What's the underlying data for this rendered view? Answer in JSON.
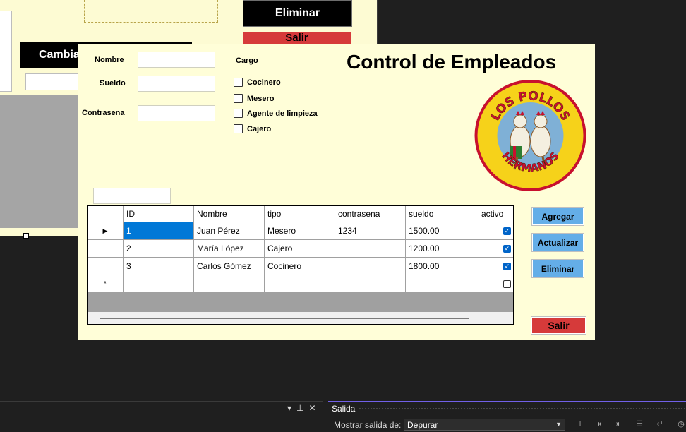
{
  "background_form": {
    "eliminar_label": "Eliminar",
    "salir_label": "Salir",
    "cambia_label": "Cambia"
  },
  "form": {
    "title": "Control de Empleados",
    "fields": {
      "nombre_label": "Nombre",
      "sueldo_label": "Sueldo",
      "contrasena_label": "Contrasena",
      "nombre_value": "",
      "sueldo_value": "",
      "contrasena_value": ""
    },
    "cargo": {
      "label": "Cargo",
      "options": [
        "Cocinero",
        "Mesero",
        "Agente de limpieza",
        "Cajero"
      ]
    },
    "logo_text": {
      "top": "LOS POLLOS",
      "bottom": "HERMANOS"
    },
    "grid": {
      "columns": [
        "ID",
        "Nombre",
        "tipo",
        "contrasena",
        "sueldo",
        "activo"
      ],
      "rows": [
        {
          "id": "1",
          "nombre": "Juan Pérez",
          "tipo": "Mesero",
          "contrasena": "1234",
          "sueldo": "1500.00",
          "activo": true
        },
        {
          "id": "2",
          "nombre": "María López",
          "tipo": "Cajero",
          "contrasena": "",
          "sueldo": "1200.00",
          "activo": true
        },
        {
          "id": "3",
          "nombre": "Carlos Gómez",
          "tipo": "Cocinero",
          "contrasena": "",
          "sueldo": "1800.00",
          "activo": true
        }
      ],
      "selected_row_marker": "▶",
      "new_row_marker": "*"
    },
    "buttons": {
      "agregar": "Agregar",
      "actualizar": "Actualizar",
      "eliminar": "Eliminar",
      "salir": "Salir"
    }
  },
  "ide": {
    "output_panel_title": "Salida",
    "show_output_from_label": "Mostrar salida de:",
    "show_output_from_value": "Depurar"
  },
  "colors": {
    "form_bg": "#fffed8",
    "button_blue": "#64aee8",
    "button_red": "#d63a3a",
    "selection_blue": "#0078d7"
  }
}
